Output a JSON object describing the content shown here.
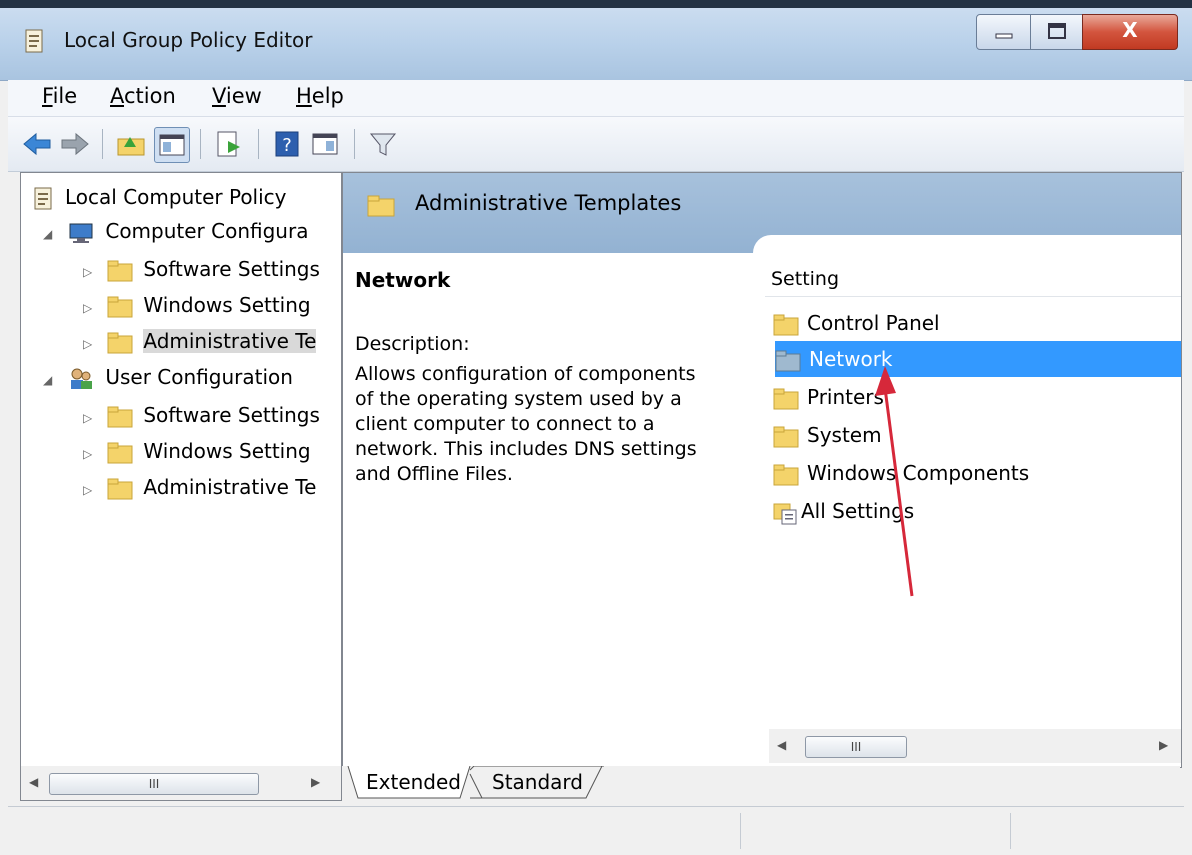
{
  "window": {
    "title": "Local Group Policy Editor",
    "controls": {
      "minimize": "▭",
      "maximize": "▢",
      "close": "X"
    }
  },
  "menu": [
    {
      "label": "File",
      "mnemonic": "F",
      "rest": "ile"
    },
    {
      "label": "Action",
      "mnemonic": "A",
      "rest": "ction"
    },
    {
      "label": "View",
      "mnemonic": "V",
      "rest": "iew"
    },
    {
      "label": "Help",
      "mnemonic": "H",
      "rest": "elp"
    }
  ],
  "toolbar": {
    "icons": [
      "back-arrow-icon",
      "forward-arrow-icon",
      "up-folder-icon",
      "show-hide-console-tree-icon",
      "export-list-icon",
      "help-icon",
      "show-hide-action-pane-icon",
      "filter-icon"
    ]
  },
  "tree": {
    "root": "Local Computer Policy",
    "computer_config": "Computer Configura",
    "computer_children": [
      "Software Settings",
      "Windows Setting",
      "Administrative Te"
    ],
    "user_config": "User Configuration",
    "user_children": [
      "Software Settings",
      "Windows Setting",
      "Administrative Te"
    ],
    "scroll_glyph": "III"
  },
  "details": {
    "header_title": "Administrative Templates",
    "selected_name": "Network",
    "description_label": "Description:",
    "description_lines": [
      "Allows configuration of components",
      "of the operating system used by a",
      "client computer to connect to a",
      "network. This includes DNS settings",
      "and Offline Files."
    ],
    "column_header": "Setting",
    "items": [
      "Control Panel",
      "Network",
      "Printers",
      "System",
      "Windows Components",
      "All Settings"
    ],
    "selected_index": 1,
    "scroll_glyph": "III"
  },
  "tabs": [
    "Extended",
    "Standard"
  ],
  "colors": {
    "selection": "#3399ff",
    "header_band": "#a7c1dc",
    "arrow": "#d6283a",
    "folder": "#f4d36a"
  }
}
